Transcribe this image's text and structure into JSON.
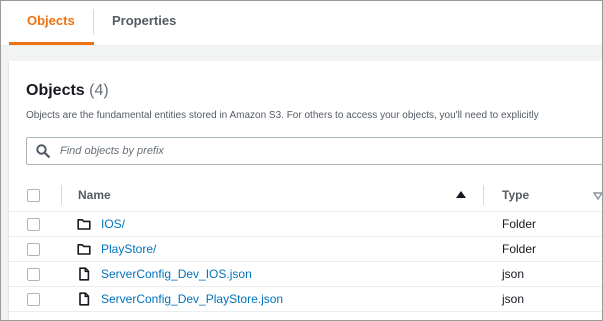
{
  "tabs": {
    "objects_label": "Objects",
    "properties_label": "Properties",
    "active": "Objects"
  },
  "panel": {
    "title": "Objects",
    "count": "(4)",
    "description": "Objects are the fundamental entities stored in Amazon S3. For others to access your objects, you'll need to explicitly"
  },
  "search": {
    "placeholder": "Find objects by prefix",
    "value": ""
  },
  "table": {
    "columns": {
      "name": "Name",
      "type": "Type"
    },
    "sort": {
      "column": "Name",
      "direction": "ascending"
    },
    "rows": [
      {
        "name": "IOS/",
        "type": "Folder",
        "icon": "folder-icon"
      },
      {
        "name": "PlayStore/",
        "type": "Folder",
        "icon": "folder-icon"
      },
      {
        "name": "ServerConfig_Dev_IOS.json",
        "type": "json",
        "icon": "file-icon"
      },
      {
        "name": "ServerConfig_Dev_PlayStore.json",
        "type": "json",
        "icon": "file-icon"
      }
    ]
  },
  "colors": {
    "accent": "#ec7211",
    "link": "#0073bb",
    "text": "#16191f",
    "muted": "#545b64"
  }
}
